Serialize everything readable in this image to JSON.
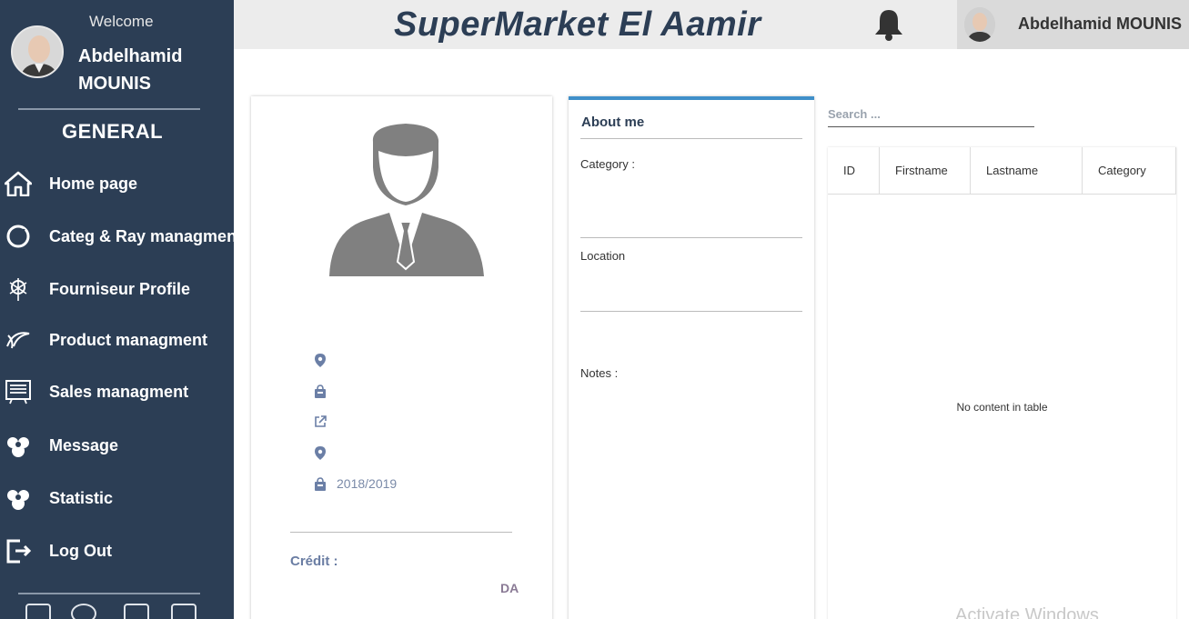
{
  "sidebar": {
    "welcome": "Welcome",
    "user_name": "Abdelhamid MOUNIS",
    "section_title": "GENERAL",
    "items": [
      {
        "label": "Home page",
        "icon": "home-icon"
      },
      {
        "label": "Categ & Ray managment",
        "icon": "category-icon"
      },
      {
        "label": "Fourniseur Profile",
        "icon": "supplier-icon"
      },
      {
        "label": "Product managment",
        "icon": "product-icon"
      },
      {
        "label": "Sales managment",
        "icon": "sales-icon"
      },
      {
        "label": "Message",
        "icon": "message-icon"
      },
      {
        "label": "Statistic",
        "icon": "statistic-icon"
      },
      {
        "label": "Log Out",
        "icon": "logout-icon"
      }
    ],
    "social_icons": [
      "facebook-icon",
      "github-icon",
      "instagram-icon",
      "youtube-icon"
    ]
  },
  "header": {
    "title": "SuperMarket El Aamir",
    "user_name": "Abdelhamid MOUNIS",
    "notification_icon": "bell-icon"
  },
  "profile": {
    "info_rows": [
      {
        "icon": "location-icon",
        "text": ""
      },
      {
        "icon": "bag-icon",
        "text": ""
      },
      {
        "icon": "external-link-icon",
        "text": ""
      },
      {
        "icon": "location-icon",
        "text": ""
      },
      {
        "icon": "bag-icon",
        "text": "2018/2019"
      }
    ],
    "credit_label": "Crédit :",
    "credit_unit": "DA"
  },
  "about": {
    "title": "About me",
    "category_label": "Category :",
    "location_label": "Location",
    "notes_label": "Notes :"
  },
  "table": {
    "search_placeholder": "Search ...",
    "columns": [
      "ID",
      "Firstname",
      "Lastname",
      "Category"
    ],
    "empty_message": "No content in table"
  },
  "system": {
    "watermark": "Activate Windows"
  },
  "colors": {
    "sidebar_bg": "#2c3e55",
    "accent": "#3f8fc9",
    "topbar_bg": "#ececec"
  }
}
